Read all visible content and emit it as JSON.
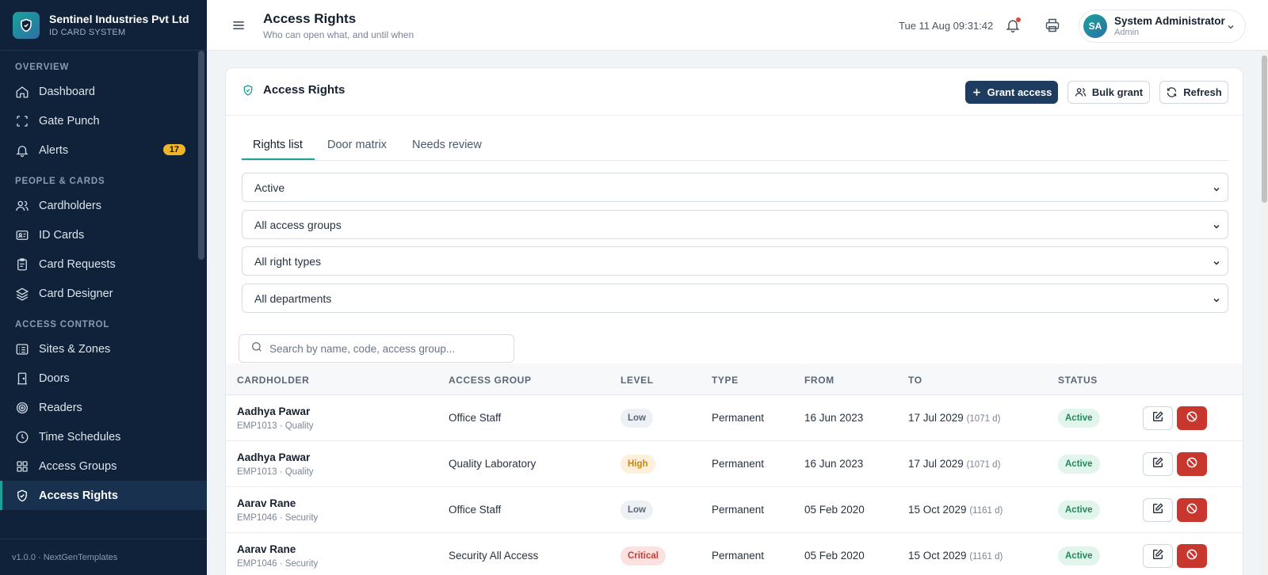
{
  "brand": {
    "name": "Sentinel Industries Pvt Ltd",
    "subtitle": "ID CARD SYSTEM"
  },
  "sidebar": {
    "sections": [
      {
        "title": "OVERVIEW",
        "items": [
          {
            "label": "Dashboard",
            "icon": "home-icon"
          },
          {
            "label": "Gate Punch",
            "icon": "scan-icon"
          },
          {
            "label": "Alerts",
            "icon": "bell-icon",
            "badge": "17"
          }
        ]
      },
      {
        "title": "PEOPLE & CARDS",
        "items": [
          {
            "label": "Cardholders",
            "icon": "users-icon"
          },
          {
            "label": "ID Cards",
            "icon": "id-card-icon"
          },
          {
            "label": "Card Requests",
            "icon": "clipboard-icon"
          },
          {
            "label": "Card Designer",
            "icon": "layers-icon"
          }
        ]
      },
      {
        "title": "ACCESS CONTROL",
        "items": [
          {
            "label": "Sites & Zones",
            "icon": "list-icon"
          },
          {
            "label": "Doors",
            "icon": "door-icon"
          },
          {
            "label": "Readers",
            "icon": "target-icon"
          },
          {
            "label": "Time Schedules",
            "icon": "clock-icon"
          },
          {
            "label": "Access Groups",
            "icon": "grid-icon"
          },
          {
            "label": "Access Rights",
            "icon": "shield-check-icon",
            "active": true
          }
        ]
      }
    ],
    "footer": "v1.0.0 · NextGenTemplates"
  },
  "header": {
    "title": "Access Rights",
    "subtitle": "Who can open what, and until when",
    "datetime": "Tue 11 Aug 09:31:42",
    "user": {
      "initials": "SA",
      "name": "System Administrator",
      "role": "Admin"
    }
  },
  "card": {
    "title": "Access Rights",
    "buttons": {
      "grant": "Grant access",
      "bulk": "Bulk grant",
      "refresh": "Refresh"
    },
    "tabs": [
      "Rights list",
      "Door matrix",
      "Needs review"
    ],
    "filters": [
      "Active",
      "All access groups",
      "All right types",
      "All departments"
    ],
    "search_placeholder": "Search by name, code, access group...",
    "columns": [
      "CARDHOLDER",
      "ACCESS GROUP",
      "LEVEL",
      "TYPE",
      "FROM",
      "TO",
      "STATUS"
    ],
    "rows": [
      {
        "name": "Aadhya Pawar",
        "meta": "EMP1013 · Quality",
        "group": "Office Staff",
        "level": "Low",
        "type": "Permanent",
        "from": "16 Jun 2023",
        "to": "17 Jul 2029",
        "days": "(1071 d)",
        "status": "Active"
      },
      {
        "name": "Aadhya Pawar",
        "meta": "EMP1013 · Quality",
        "group": "Quality Laboratory",
        "level": "High",
        "type": "Permanent",
        "from": "16 Jun 2023",
        "to": "17 Jul 2029",
        "days": "(1071 d)",
        "status": "Active"
      },
      {
        "name": "Aarav Rane",
        "meta": "EMP1046 · Security",
        "group": "Office Staff",
        "level": "Low",
        "type": "Permanent",
        "from": "05 Feb 2020",
        "to": "15 Oct 2029",
        "days": "(1161 d)",
        "status": "Active"
      },
      {
        "name": "Aarav Rane",
        "meta": "EMP1046 · Security",
        "group": "Security All Access",
        "level": "Critical",
        "type": "Permanent",
        "from": "05 Feb 2020",
        "to": "15 Oct 2029",
        "days": "(1161 d)",
        "status": "Active"
      }
    ]
  },
  "colors": {
    "sidebar_bg": "#0f2239",
    "accent": "#1aa39a",
    "primary": "#1d3c60",
    "danger": "#c8372e",
    "alert_badge": "#f0b429"
  }
}
